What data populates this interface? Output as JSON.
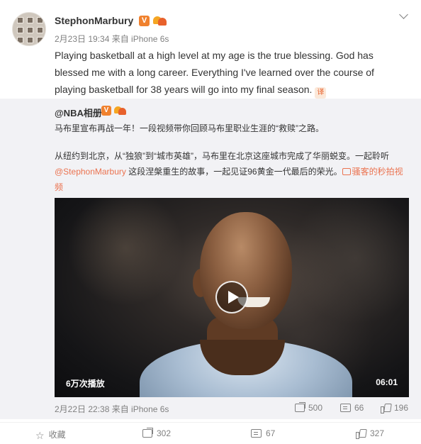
{
  "post": {
    "username": "StephonMarbury",
    "verified_badge": "V",
    "meta": "2月23日 19:34 来自 iPhone 6s",
    "text": "Playing basketball at a high level at my age is the true blessing. God has blessed me with a long career. Everything I've learned over the course of playing basketball for 38 years will go into my final season.",
    "translate_icon": "译"
  },
  "repost": {
    "username": "@NBA相册",
    "verified_badge": "V",
    "text1": "马布里宣布再战一年！一段视频带你回顾马布里职业生涯的“救赎”之路。",
    "text2_part1": "从纽约到北京，从“独狼”到“城市英雄”，马布里在北京这座城市完成了华丽蜕变。一起聆听",
    "text2_mention": "@StephonMarbury",
    "text2_part2": " 这段涅槃重生的故事，一起见证96黄金一代最后的荣光。",
    "video_link": "骚客的秒拍视频",
    "video": {
      "plays": "6万次播放",
      "duration": "06:01"
    },
    "meta": "2月22日 22:38 来自 iPhone 6s",
    "shares": "500",
    "comments": "66",
    "likes": "196"
  },
  "bottom_bar": {
    "favorite_label": "收藏",
    "share_count": "302",
    "comment_count": "67",
    "like_count": "327"
  },
  "colors": {
    "link": "#eb7350",
    "verified": "#f0812e",
    "meta_gray": "#808080",
    "repost_bg": "#f2f2f5"
  },
  "icons": [
    "avatar",
    "verified-icon",
    "member-icon",
    "chevron-down-icon",
    "translate-icon",
    "video-link-icon",
    "play-icon",
    "share-icon",
    "comment-icon",
    "like-icon",
    "star-icon"
  ]
}
